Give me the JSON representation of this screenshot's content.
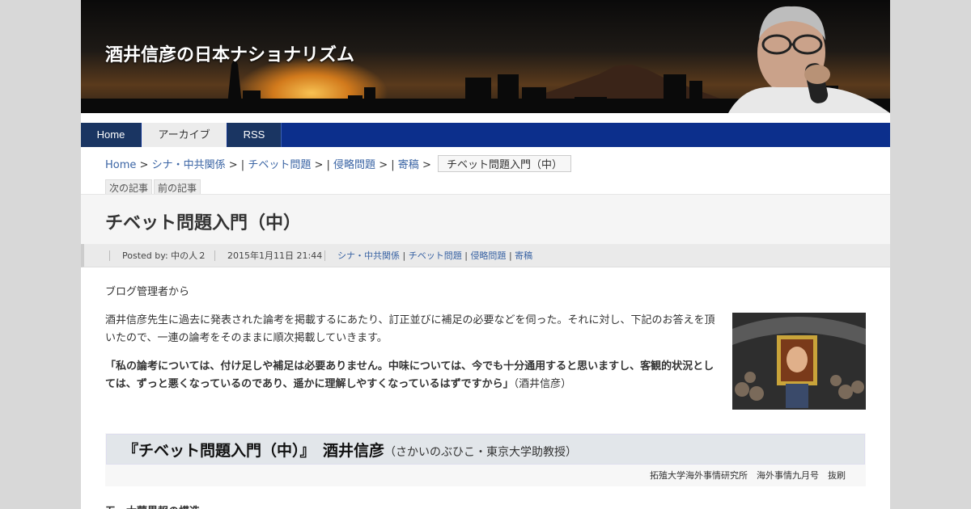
{
  "site": {
    "title": "酒井信彦の日本ナショナリズム"
  },
  "nav": [
    {
      "label": "Home"
    },
    {
      "label": "アーカイブ"
    },
    {
      "label": "RSS"
    }
  ],
  "breadcrumb": {
    "home": "Home",
    "sep": ">",
    "pipe": "|",
    "categories": [
      "シナ・中共関係",
      "チベット問題",
      "侵略問題",
      "寄稿"
    ],
    "current": "チベット問題入門（中）"
  },
  "post_nav": {
    "next": "次の記事",
    "prev": "前の記事"
  },
  "post": {
    "title": "チベット問題入門（中）",
    "meta": {
      "posted_by": "Posted by: 中の人２",
      "date": "2015年1月11日 21:44",
      "categories": [
        "シナ・中共関係",
        "チベット問題",
        "侵略問題",
        "寄稿"
      ]
    },
    "intro": "ブログ管理者から",
    "para1": "酒井信彦先生に過去に発表された論考を掲載するにあたり、訂正並びに補足の必要などを伺った。それに対し、下記のお答えを頂いたので、一連の論考をそのままに順次掲載していきます。",
    "quote": "「私の論考については、付け足しや補足は必要ありません。中味については、今でも十分通用すると思いますし、客観的状況としては、ずっと悪くなっているのであり、遥かに理解しやすくなっているはずですから」",
    "quote_attr": "（酒井信彦）",
    "box": {
      "title": "『チベット問題入門（中）』　酒井信彦",
      "subtitle": "（さかいのぶひこ・東京大学助教授）",
      "source": "拓殖大学海外事情研究所　海外事情九月号　抜刷"
    },
    "section": "五、大蒙界報の構造"
  },
  "colors": {
    "nav_bg": "#0c2f8c",
    "link": "#3a64a4"
  },
  "icons": {
    "header_photo": "speaker-portrait",
    "post_photo": "portrait-photo"
  }
}
